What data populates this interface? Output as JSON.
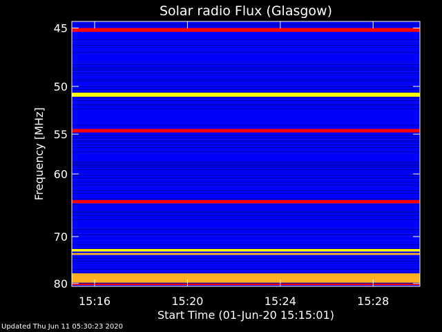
{
  "chart_data": {
    "type": "heatmap",
    "title": "Solar radio Flux (Glasgow)",
    "xlabel": "Start Time (01-Jun-20 15:15:01)",
    "ylabel": "Frequency [MHz]",
    "y_scale": "reciprocal",
    "ylim": [
      44.5,
      80.7
    ],
    "xlim": [
      "15:15:01",
      "15:30:01"
    ],
    "x_ticks": [
      "15:16",
      "15:20",
      "15:24",
      "15:28"
    ],
    "y_ticks": [
      45,
      50,
      55,
      60,
      70,
      80
    ],
    "colormap": [
      "#000080",
      "#0000ff",
      "#ff0000",
      "#ffff00",
      "#ffffff"
    ],
    "background_level": "low (blue)",
    "bands": [
      {
        "mhz_low": 45.0,
        "mhz_high": 45.3,
        "level": "medium"
      },
      {
        "mhz_low": 50.6,
        "mhz_high": 51.0,
        "level": "very high"
      },
      {
        "mhz_low": 54.4,
        "mhz_high": 54.8,
        "level": "medium"
      },
      {
        "mhz_low": 63.8,
        "mhz_high": 64.3,
        "level": "medium"
      },
      {
        "mhz_low": 72.4,
        "mhz_high": 72.9,
        "level": "very high"
      },
      {
        "mhz_low": 73.2,
        "mhz_high": 73.6,
        "level": "high"
      },
      {
        "mhz_low": 77.6,
        "mhz_high": 79.8,
        "level": "high"
      },
      {
        "mhz_low": 80.0,
        "mhz_high": 80.4,
        "level": "medium"
      }
    ]
  },
  "footer_text": "Updated Thu Jun 11 05:30:23 2020"
}
